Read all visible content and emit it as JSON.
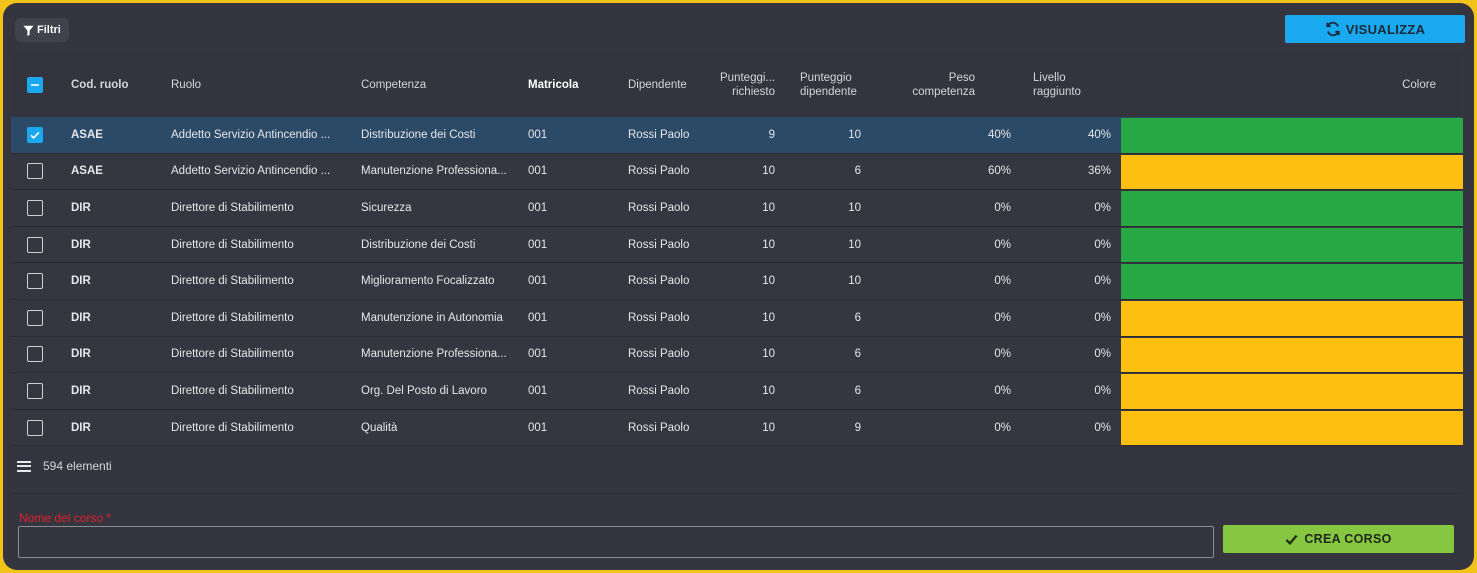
{
  "toolbar": {
    "filter_label": "Filtri",
    "visualizza_label": "VISUALIZZA"
  },
  "table": {
    "headers": {
      "cod": "Cod. ruolo",
      "ruolo": "Ruolo",
      "competenza": "Competenza",
      "matricola": "Matricola",
      "dipendente": "Dipendente",
      "punteggio_richiesto": "Punteggi...\nrichiesto",
      "punteggio_dipendente": "Punteggio\ndipendente",
      "peso": "Peso\ncompetenza",
      "livello": "Livello\nraggiunto",
      "colore": "Colore"
    },
    "rows": [
      {
        "checked": true,
        "cod": "ASAE",
        "ruolo": "Addetto Servizio Antincendio ...",
        "competenza": "Distribuzione dei Costi",
        "matricola": "001",
        "dipendente": "Rossi Paolo",
        "preq": "9",
        "pdip": "10",
        "peso": "40%",
        "livello": "40%",
        "colore": "#28a745"
      },
      {
        "checked": false,
        "cod": "ASAE",
        "ruolo": "Addetto Servizio Antincendio ...",
        "competenza": "Manutenzione Professiona...",
        "matricola": "001",
        "dipendente": "Rossi Paolo",
        "preq": "10",
        "pdip": "6",
        "peso": "60%",
        "livello": "36%",
        "colore": "#fdc010"
      },
      {
        "checked": false,
        "cod": "DIR",
        "ruolo": "Direttore di Stabilimento",
        "competenza": "Sicurezza",
        "matricola": "001",
        "dipendente": "Rossi Paolo",
        "preq": "10",
        "pdip": "10",
        "peso": "0%",
        "livello": "0%",
        "colore": "#28a745"
      },
      {
        "checked": false,
        "cod": "DIR",
        "ruolo": "Direttore di Stabilimento",
        "competenza": "Distribuzione dei Costi",
        "matricola": "001",
        "dipendente": "Rossi Paolo",
        "preq": "10",
        "pdip": "10",
        "peso": "0%",
        "livello": "0%",
        "colore": "#28a745"
      },
      {
        "checked": false,
        "cod": "DIR",
        "ruolo": "Direttore di Stabilimento",
        "competenza": "Miglioramento Focalizzato",
        "matricola": "001",
        "dipendente": "Rossi Paolo",
        "preq": "10",
        "pdip": "10",
        "peso": "0%",
        "livello": "0%",
        "colore": "#28a745"
      },
      {
        "checked": false,
        "cod": "DIR",
        "ruolo": "Direttore di Stabilimento",
        "competenza": "Manutenzione in Autonomia",
        "matricola": "001",
        "dipendente": "Rossi Paolo",
        "preq": "10",
        "pdip": "6",
        "peso": "0%",
        "livello": "0%",
        "colore": "#fdc010"
      },
      {
        "checked": false,
        "cod": "DIR",
        "ruolo": "Direttore di Stabilimento",
        "competenza": "Manutenzione Professiona...",
        "matricola": "001",
        "dipendente": "Rossi Paolo",
        "preq": "10",
        "pdip": "6",
        "peso": "0%",
        "livello": "0%",
        "colore": "#fdc010"
      },
      {
        "checked": false,
        "cod": "DIR",
        "ruolo": "Direttore di Stabilimento",
        "competenza": "Org. Del Posto di Lavoro",
        "matricola": "001",
        "dipendente": "Rossi Paolo",
        "preq": "10",
        "pdip": "6",
        "peso": "0%",
        "livello": "0%",
        "colore": "#fdc010"
      },
      {
        "checked": false,
        "cod": "DIR",
        "ruolo": "Direttore di Stabilimento",
        "competenza": "Qualità",
        "matricola": "001",
        "dipendente": "Rossi Paolo",
        "preq": "10",
        "pdip": "9",
        "peso": "0%",
        "livello": "0%",
        "colore": "#fdc010"
      }
    ]
  },
  "footer": {
    "count_label": "594 elementi"
  },
  "form": {
    "course_label": "Nome del corso *",
    "course_value": "",
    "crea_label": "CREA CORSO"
  },
  "colors": {
    "accent": "#1aa8ee",
    "success": "#86c641",
    "green": "#28a745",
    "yellow": "#fdc010",
    "required": "#e0212c"
  }
}
